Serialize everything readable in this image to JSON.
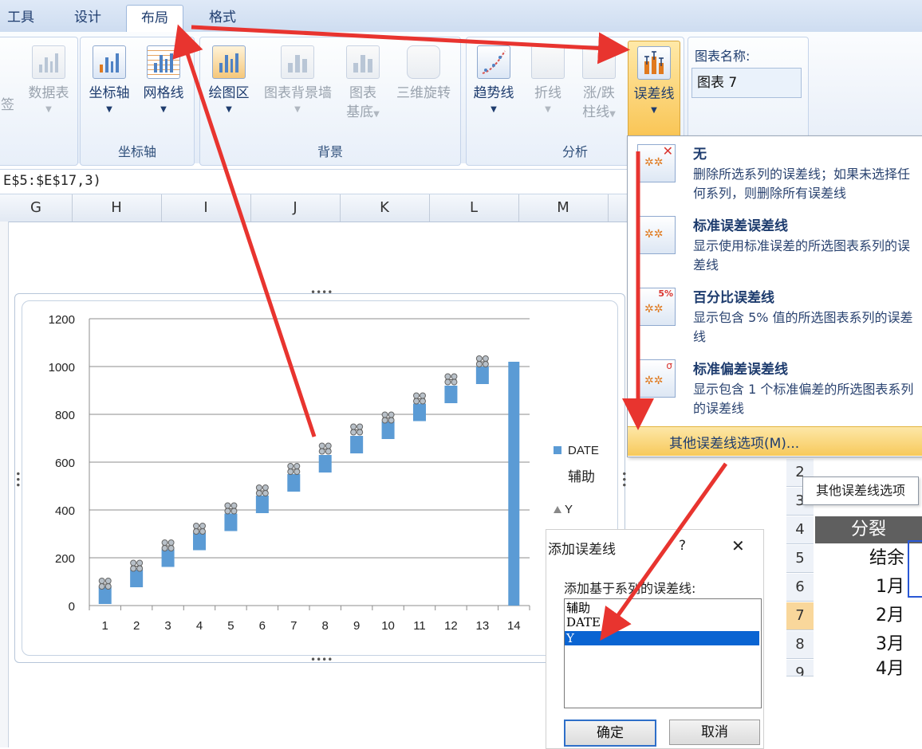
{
  "tabs": [
    "工具",
    "设计",
    "布局",
    "格式"
  ],
  "ribbon": {
    "btn_dataTable": "数据表",
    "btn_dataTable_prefix": "签",
    "btn_axes": "坐标轴",
    "btn_gridlines": "网格线",
    "btn_plotArea": "绘图区",
    "btn_wall": "图表背景墙",
    "btn_floor1": "图表",
    "btn_floor2": "基底",
    "btn_rotate": "三维旋转",
    "btn_trend": "趋势线",
    "btn_lines": "折线",
    "btn_updown1": "涨/跌",
    "btn_updown2": "柱线",
    "btn_errbars": "误差线",
    "group_axes": "坐标轴",
    "group_bg": "背景",
    "group_analysis": "分析",
    "chartname_label": "图表名称:",
    "chartname_value": "图表 7"
  },
  "formula": "E$5:$E$17,3)",
  "columns": [
    "G",
    "H",
    "I",
    "J",
    "K",
    "L",
    "M"
  ],
  "menu": {
    "items": [
      {
        "title": "无",
        "desc": "删除所选系列的误差线；如果未选择任何系列，则删除所有误差线"
      },
      {
        "title": "标准误差误差线",
        "desc": "显示使用标准误差的所选图表系列的误差线"
      },
      {
        "title": "百分比误差线",
        "desc": "显示包含 5% 值的所选图表系列的误差线"
      },
      {
        "title": "标准偏差误差线",
        "desc": "显示包含 1 个标准偏差的所选图表系列的误差线"
      }
    ],
    "pct_badge": "5%",
    "more": "其他误差线选项(M)..."
  },
  "tooltip": "其他误差线选项",
  "sheet": {
    "rows": [
      "2",
      "3",
      "4",
      "5",
      "6",
      "7",
      "8",
      "9"
    ],
    "header": "分裂",
    "cells": [
      "",
      "",
      "",
      "结余",
      "1月",
      "2月",
      "3月",
      "4月"
    ]
  },
  "dialog": {
    "title": "添加误差线",
    "help": "?",
    "close": "✕",
    "label": "添加基于系列的误差线:",
    "items": [
      "辅助",
      "DATE",
      "Y"
    ],
    "selected_index": 2,
    "ok": "确定",
    "cancel": "取消"
  },
  "colors": {
    "bar": "#5b9bd5",
    "arrow": "#e8342f",
    "accent": "#f7c95b"
  },
  "chart_data": {
    "type": "bar",
    "categories": [
      "1",
      "2",
      "3",
      "4",
      "5",
      "6",
      "7",
      "8",
      "9",
      "10",
      "11",
      "12",
      "13",
      "14"
    ],
    "series": [
      {
        "name": "DATE",
        "values": [
          80,
          150,
          235,
          305,
          385,
          460,
          550,
          630,
          710,
          770,
          845,
          920,
          1000,
          1020
        ]
      },
      {
        "name": "辅助",
        "values": []
      },
      {
        "name": "Y",
        "values": [
          90,
          165,
          250,
          320,
          405,
          480,
          570,
          655,
          735,
          785,
          865,
          945,
          1020,
          null
        ]
      }
    ],
    "ylim": [
      0,
      1200
    ],
    "yticks": [
      0,
      200,
      400,
      600,
      800,
      1000,
      1200
    ],
    "grid": true,
    "legend": "right"
  }
}
